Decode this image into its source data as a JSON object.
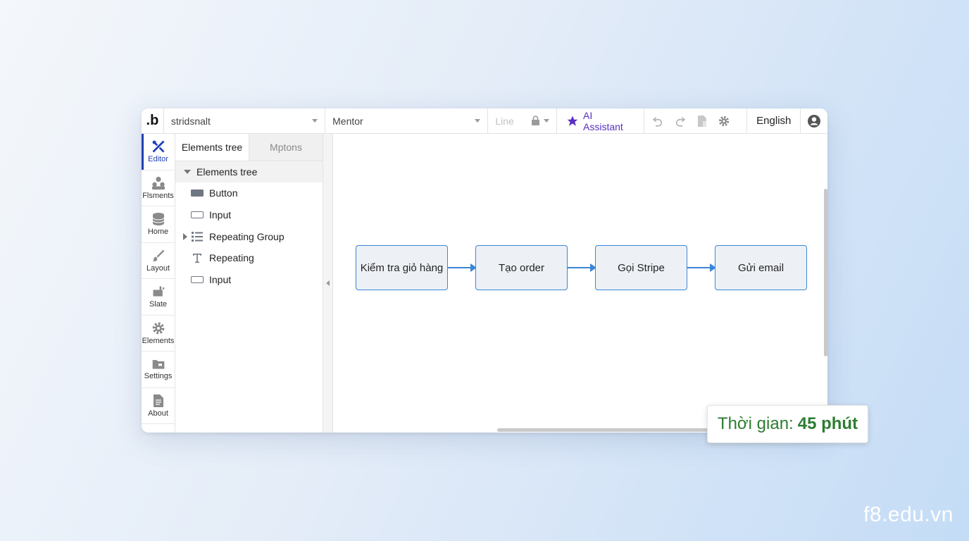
{
  "topbar": {
    "logo": ".b",
    "app_name": "stridsnalt",
    "page_name": "Mentor",
    "line_label": "Line",
    "ai_label": "AI Assistant",
    "language": "English"
  },
  "rail": {
    "items": [
      {
        "label": "Editor",
        "icon": "tools-icon",
        "active": true
      },
      {
        "label": "Flsments",
        "icon": "users-icon"
      },
      {
        "label": "Home",
        "icon": "database-icon"
      },
      {
        "label": "Layout",
        "icon": "brush-icon"
      },
      {
        "label": "Slate",
        "icon": "plugin-icon"
      },
      {
        "label": "Elements",
        "icon": "gear-icon"
      },
      {
        "label": "Settings",
        "icon": "folder-icon"
      },
      {
        "label": "About",
        "icon": "document-icon"
      }
    ]
  },
  "panel": {
    "tabs": [
      {
        "label": "Elements tree",
        "active": true
      },
      {
        "label": "Mptons",
        "active": false
      }
    ],
    "tree_title": "Elements tree",
    "rows": [
      {
        "label": "Button",
        "icon": "button-icon"
      },
      {
        "label": "Input",
        "icon": "input-icon"
      },
      {
        "label": "Repeating Group",
        "icon": "repeating-group-icon",
        "expandable": true
      },
      {
        "label": "Repeating",
        "icon": "text-icon"
      },
      {
        "label": "Input",
        "icon": "input-icon"
      }
    ]
  },
  "flow": {
    "steps": [
      "Kiểm tra giỏ hàng",
      "Tạo order",
      "Gọi Stripe",
      "Gửi email"
    ]
  },
  "badge": {
    "prefix": "Thời gian:",
    "value": "45 phút"
  },
  "watermark": "f8.edu.vn",
  "colors": {
    "accent": "#1f3fb5",
    "ai": "#5a2fc2",
    "flow_border": "#3b86d6",
    "badge_text": "#2e7d32"
  }
}
